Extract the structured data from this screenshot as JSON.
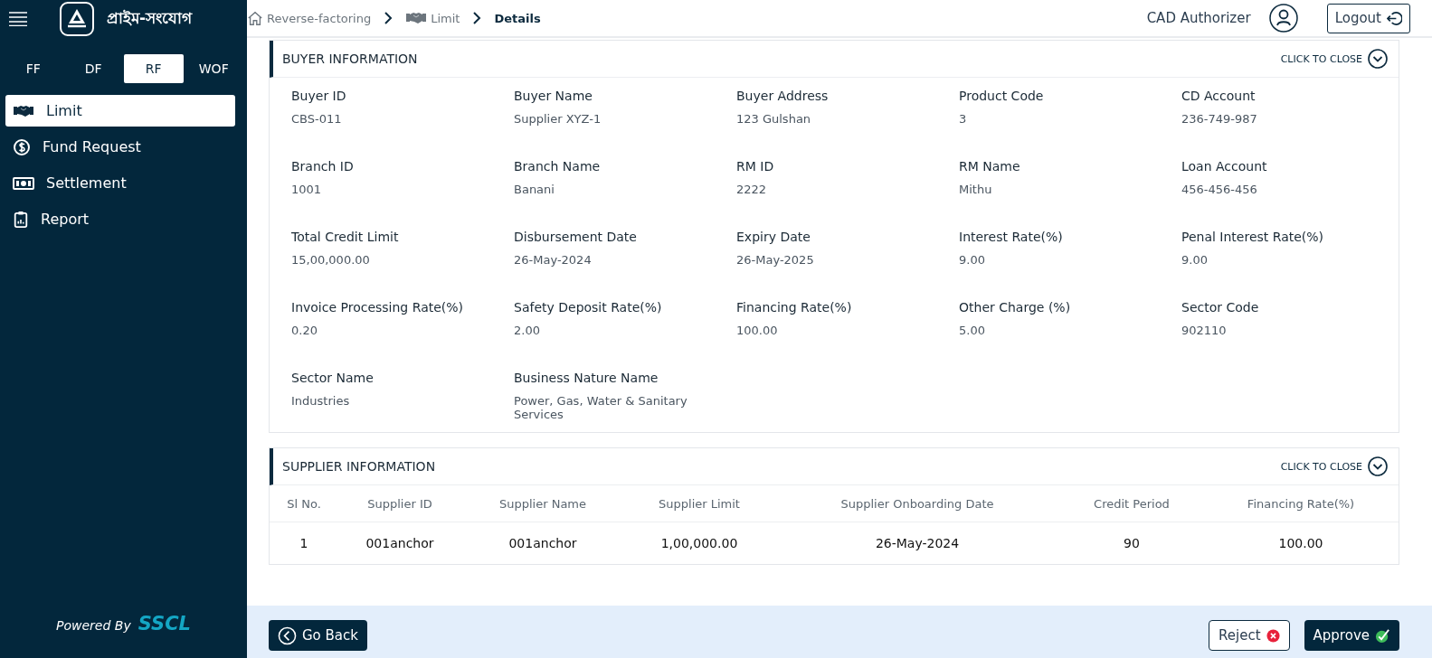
{
  "brand": {
    "name": "প্রাইম-সংযোগ"
  },
  "module_tabs": [
    {
      "label": "FF",
      "selected": false
    },
    {
      "label": "DF",
      "selected": false
    },
    {
      "label": "RF",
      "selected": true
    },
    {
      "label": "WOF",
      "selected": false
    }
  ],
  "sidebar": {
    "items": [
      {
        "label": "Limit",
        "kind": "handshake",
        "selected": true
      },
      {
        "label": "Fund Request",
        "kind": "dollar",
        "selected": false
      },
      {
        "label": "Settlement",
        "kind": "cash",
        "selected": false
      },
      {
        "label": "Report",
        "kind": "clipboard",
        "selected": false
      }
    ],
    "powered_by": "Powered By",
    "powered_brand": "SSCL"
  },
  "breadcrumb": [
    {
      "label": "Reverse-factoring",
      "kind": "home"
    },
    {
      "label": "Limit",
      "kind": "handshake"
    },
    {
      "label": "Details",
      "kind": "current"
    }
  ],
  "user": {
    "role": "CAD Authorizer",
    "logout": "Logout"
  },
  "buyer_section": {
    "title": "BUYER INFORMATION",
    "toggle": "CLICK TO CLOSE",
    "fields": [
      {
        "label": "Buyer ID",
        "value": "CBS-011"
      },
      {
        "label": "Buyer Name",
        "value": "Supplier XYZ-1"
      },
      {
        "label": "Buyer Address",
        "value": "123 Gulshan"
      },
      {
        "label": "Product Code",
        "value": "3"
      },
      {
        "label": "CD Account",
        "value": "236-749-987"
      },
      {
        "label": "Branch ID",
        "value": "1001"
      },
      {
        "label": "Branch Name",
        "value": "Banani"
      },
      {
        "label": "RM ID",
        "value": "2222"
      },
      {
        "label": "RM Name",
        "value": "Mithu"
      },
      {
        "label": "Loan Account",
        "value": "456-456-456"
      },
      {
        "label": "Total Credit Limit",
        "value": "15,00,000.00"
      },
      {
        "label": "Disbursement Date",
        "value": "26-May-2024"
      },
      {
        "label": "Expiry Date",
        "value": "26-May-2025"
      },
      {
        "label": "Interest Rate(%)",
        "value": "9.00"
      },
      {
        "label": "Penal Interest Rate(%)",
        "value": "9.00"
      },
      {
        "label": "Invoice Processing Rate(%)",
        "value": "0.20"
      },
      {
        "label": "Safety Deposit Rate(%)",
        "value": "2.00"
      },
      {
        "label": "Financing Rate(%)",
        "value": "100.00"
      },
      {
        "label": "Other Charge (%)",
        "value": "5.00"
      },
      {
        "label": "Sector Code",
        "value": "902110"
      },
      {
        "label": "Sector Name",
        "value": "Industries"
      },
      {
        "label": "Business Nature Name",
        "value": "Power, Gas, Water & Sanitary Services"
      }
    ]
  },
  "supplier_section": {
    "title": "SUPPLIER INFORMATION",
    "toggle": "CLICK TO CLOSE",
    "table": {
      "columns": [
        "Sl No.",
        "Supplier ID",
        "Supplier Name",
        "Supplier Limit",
        "Supplier Onboarding Date",
        "Credit Period",
        "Financing Rate(%)"
      ],
      "rows": [
        [
          "1",
          "001anchor",
          "001anchor",
          "1,00,000.00",
          "26-May-2024",
          "90",
          "100.00"
        ]
      ]
    }
  },
  "actions": {
    "back": "Go Back",
    "reject": "Reject",
    "approve": "Approve"
  }
}
